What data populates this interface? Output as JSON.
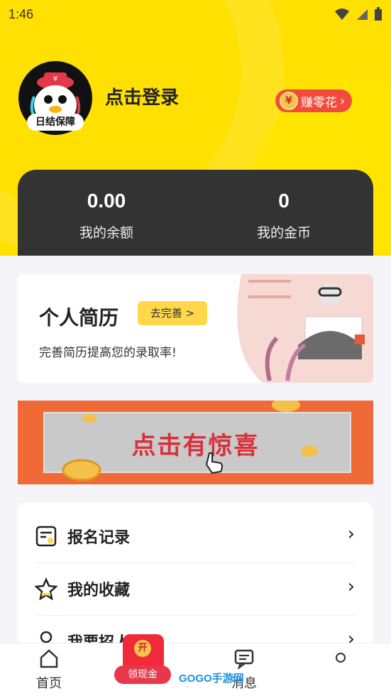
{
  "status_bar": {
    "time": "1:46"
  },
  "profile": {
    "avatar_badge": "日结保障",
    "login_text": "点击登录",
    "earn_button": "赚零花",
    "earn_coin": "¥"
  },
  "wallet": {
    "balance_value": "0.00",
    "balance_label": "我的余额",
    "coins_value": "0",
    "coins_label": "我的金币"
  },
  "resume": {
    "title": "个人简历",
    "button": "去完善 >",
    "subtitle": "完善简历提高您的录取率!"
  },
  "banner": {
    "text": "点击有惊喜"
  },
  "menu": {
    "items": [
      {
        "label": "报名记录"
      },
      {
        "label": "我的收藏"
      },
      {
        "label": "我要招人"
      }
    ]
  },
  "tabbar": {
    "home": "首页",
    "redpack_top": "开",
    "redpack_label": "领现金",
    "messages": "消息"
  },
  "watermark": "GOGO手游网",
  "colors": {
    "brand_yellow": "#ffe000",
    "dark": "#333333",
    "accent_red": "#f24a3c"
  }
}
